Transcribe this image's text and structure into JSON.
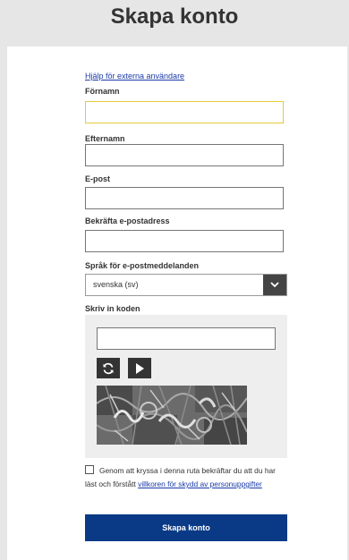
{
  "page": {
    "title": "Skapa konto",
    "help_link": "Hjälp för externa användare"
  },
  "form": {
    "first_name": {
      "label": "Förnamn",
      "value": ""
    },
    "last_name": {
      "label": "Efternamn",
      "value": ""
    },
    "email": {
      "label": "E-post",
      "value": ""
    },
    "email_confirm": {
      "label": "Bekräfta e-postadress",
      "value": ""
    },
    "language": {
      "label": "Språk för e-postmeddelanden",
      "selected": "svenska (sv)"
    },
    "captcha": {
      "label": "Skriv in koden",
      "value": ""
    },
    "consent": {
      "checked": false,
      "text": "Genom att kryssa i denna ruta bekräftar du att du har läst och förstått",
      "link": "villkoren för skydd av personuppgifter"
    },
    "submit_label": "Skapa konto"
  },
  "icons": {
    "refresh": "refresh-icon",
    "play": "play-icon",
    "chevron": "chevron-down-icon"
  },
  "colors": {
    "submit_bg": "#0a3a86",
    "link": "#1a3aa8",
    "focus_border": "#e6c93a"
  }
}
